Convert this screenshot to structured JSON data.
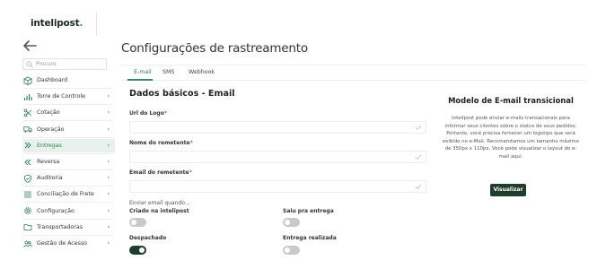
{
  "header": {
    "logo_text": "intelipost",
    "logo_dot": "."
  },
  "sidebar": {
    "search_placeholder": "Procure",
    "items": [
      {
        "label": "Dashboard",
        "icon": "package-icon",
        "has_chevron": false,
        "active": false
      },
      {
        "label": "Torre de Controle",
        "icon": "bar-chart-icon",
        "has_chevron": true,
        "active": false
      },
      {
        "label": "Cotação",
        "icon": "scissors-icon",
        "has_chevron": true,
        "active": false
      },
      {
        "label": "Operação",
        "icon": "truck-icon",
        "has_chevron": true,
        "active": false
      },
      {
        "label": "Entregas",
        "icon": "chevrons-right-icon",
        "has_chevron": true,
        "active": true
      },
      {
        "label": "Reversa",
        "icon": "chevrons-left-icon",
        "has_chevron": true,
        "active": false
      },
      {
        "label": "Auditoria",
        "icon": "shield-check-icon",
        "has_chevron": true,
        "active": false
      },
      {
        "label": "Conciliação de Frete",
        "icon": "list-icon",
        "has_chevron": true,
        "active": false
      },
      {
        "label": "Configuração",
        "icon": "gear-icon",
        "has_chevron": true,
        "active": false
      },
      {
        "label": "Transportadoras",
        "icon": "folder-icon",
        "has_chevron": true,
        "active": false
      },
      {
        "label": "Gestão de Acesso",
        "icon": "users-icon",
        "has_chevron": true,
        "active": false
      }
    ],
    "chevron_glyph": "‹"
  },
  "page": {
    "title": "Configurações de rastreamento",
    "tabs": [
      {
        "label": "E-mail",
        "active": true
      },
      {
        "label": "SMS",
        "active": false
      },
      {
        "label": "Webhook",
        "active": false
      }
    ]
  },
  "form": {
    "section_title": "Dados básicos - Email",
    "fields": [
      {
        "label": "Url do Logo",
        "required_mark": "*",
        "value": ""
      },
      {
        "label": "Nome do remetente",
        "required_mark": "*",
        "value": ""
      },
      {
        "label": "Email do remetente",
        "required_mark": "*",
        "value": ""
      }
    ],
    "send_when_label": "Enviar email quando...",
    "toggles": [
      {
        "label": "Criado na intelipost",
        "on": false
      },
      {
        "label": "Saiu pra entrega",
        "on": false
      },
      {
        "label": "Despachado",
        "on": true
      },
      {
        "label": "Entrega realizada",
        "on": false
      }
    ]
  },
  "template": {
    "title": "Modelo de E-mail transicional",
    "description": "Intelipost pode enviar e-mails transacionais para informar seus clientes sobre o status de seus pedidos. Portanto, você precisa fornecer um logotipo que será exibido no e-Mail. Recomendamos um tamanho máximo de 350px x 110px. Você pode visualizar o layout do e-mail aqui.",
    "button_label": "Visualizar"
  },
  "colors": {
    "accent": "#2e7a52",
    "dark_green": "#1e3d2b",
    "active_bg": "#e8f2ec",
    "required": "#d9534f"
  }
}
